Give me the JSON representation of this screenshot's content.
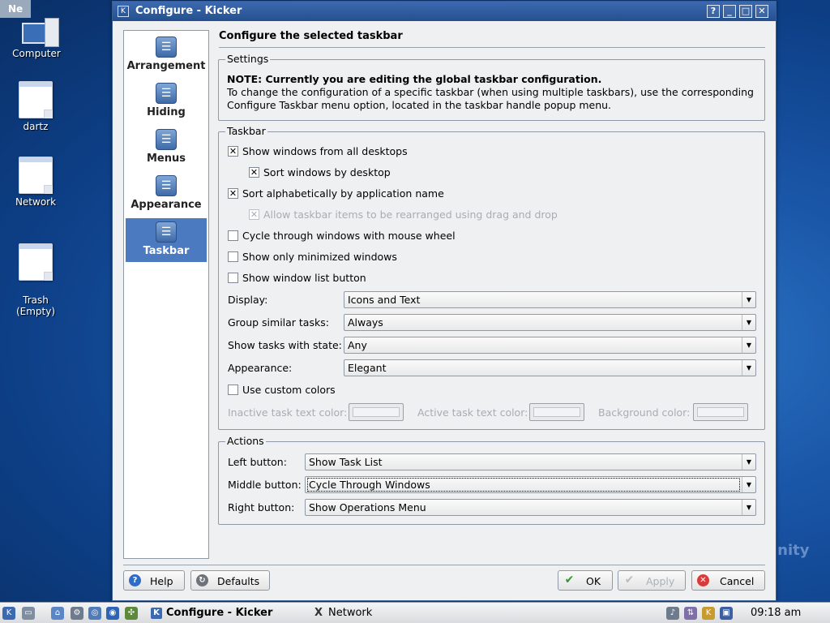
{
  "desktop": {
    "ne_tab": "Ne",
    "icons": [
      {
        "label": "Computer"
      },
      {
        "label": "dartz"
      },
      {
        "label": "Network"
      },
      {
        "label": "Trash\n(Empty)"
      }
    ],
    "watermark": "inity"
  },
  "window": {
    "title": "Configure - Kicker",
    "buttons": {
      "help": "?",
      "minimize": "_",
      "maximize": "□",
      "close": "✕"
    }
  },
  "nav": [
    {
      "label": "Arrangement",
      "icon": "kicker-icon",
      "selected": false
    },
    {
      "label": "Hiding",
      "icon": "kicker-icon",
      "selected": false
    },
    {
      "label": "Menus",
      "icon": "kicker-icon",
      "selected": false
    },
    {
      "label": "Appearance",
      "icon": "kicker-icon",
      "selected": false
    },
    {
      "label": "Taskbar",
      "icon": "kicker-icon",
      "selected": true
    }
  ],
  "page_title": "Configure the selected taskbar",
  "settings": {
    "title": "Settings",
    "note": "NOTE: Currently you are editing the global taskbar configuration.",
    "line1": "To change the configuration of a specific taskbar (when using multiple taskbars), use the corresponding",
    "line2": "Configure Taskbar menu option, located in the taskbar handle popup menu."
  },
  "taskbar_group": {
    "title": "Taskbar",
    "checkboxes": [
      {
        "label": "Show windows from all desktops",
        "checked": true,
        "enabled": true
      },
      {
        "label": "Sort windows by desktop",
        "checked": true,
        "enabled": true
      },
      {
        "label": "Sort alphabetically by application name",
        "checked": true,
        "enabled": true
      },
      {
        "label": "Allow taskbar items to be rearranged using drag and drop",
        "checked": true,
        "enabled": false
      },
      {
        "label": "Cycle through windows with mouse wheel",
        "checked": false,
        "enabled": true
      },
      {
        "label": "Show only minimized windows",
        "checked": false,
        "enabled": true
      },
      {
        "label": "Show window list button",
        "checked": false,
        "enabled": true
      }
    ],
    "combos": [
      {
        "label": "Display:",
        "value": "Icons and Text"
      },
      {
        "label": "Group similar tasks:",
        "value": "Always"
      },
      {
        "label": "Show tasks with state:",
        "value": "Any"
      },
      {
        "label": "Appearance:",
        "value": "Elegant"
      }
    ],
    "custom_colors": {
      "label": "Use custom colors",
      "checked": false
    },
    "colors": [
      {
        "label": "Inactive task text color:"
      },
      {
        "label": "Active task text color:"
      },
      {
        "label": "Background color:"
      }
    ]
  },
  "actions": {
    "title": "Actions",
    "combos": [
      {
        "label": "Left button:",
        "value": "Show Task List"
      },
      {
        "label": "Middle button:",
        "value": "Cycle Through Windows"
      },
      {
        "label": "Right button:",
        "value": "Show Operations Menu"
      }
    ]
  },
  "footer": {
    "help": "Help",
    "defaults": "Defaults",
    "ok": "OK",
    "apply": "Apply",
    "cancel": "Cancel"
  },
  "panel": {
    "tasks": [
      {
        "label": "Configure - Kicker",
        "active": true
      },
      {
        "label": "Network",
        "active": false
      }
    ],
    "clock": "09:18 am"
  }
}
